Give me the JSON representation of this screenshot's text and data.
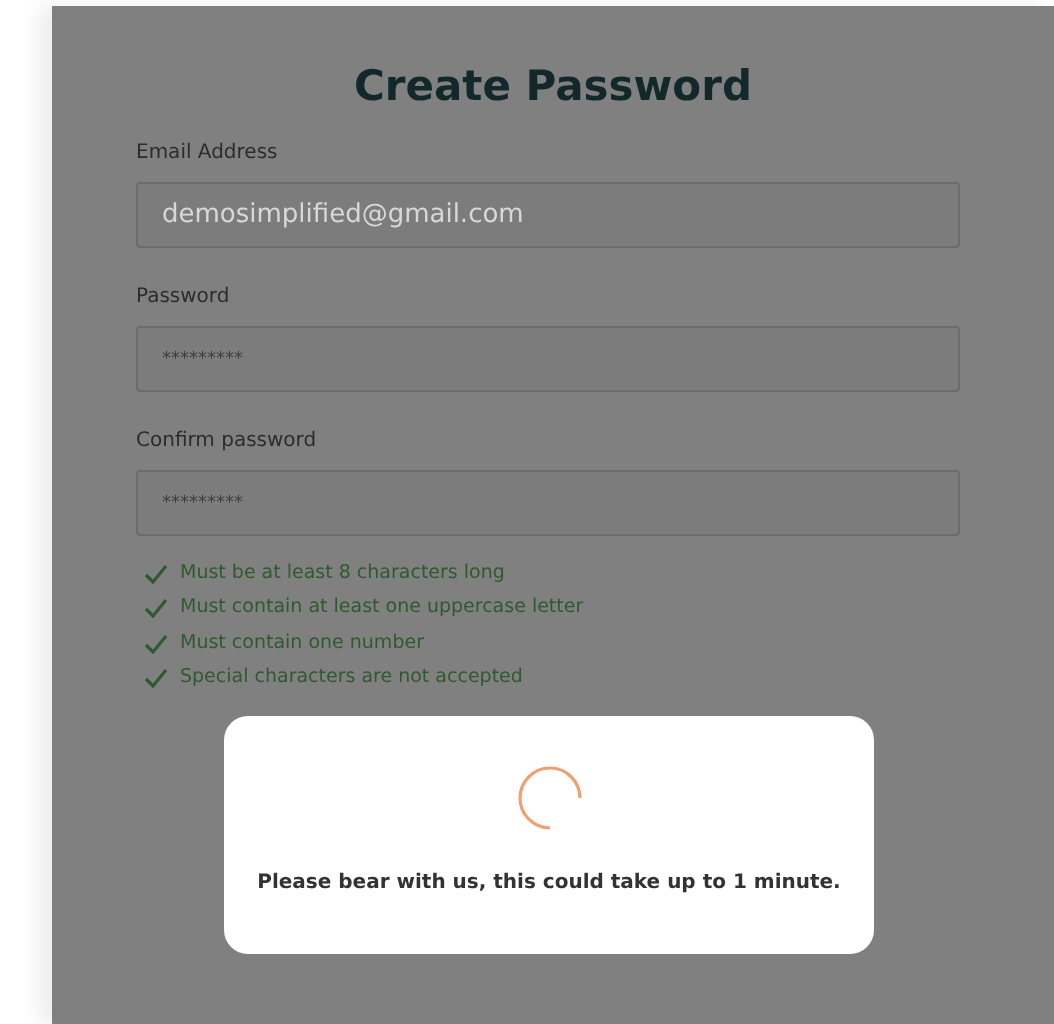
{
  "form": {
    "title": "Create Password",
    "fields": [
      {
        "label": "Email Address",
        "value": "demosimplified@gmail.com",
        "kind": "text"
      },
      {
        "label": "Password",
        "value": "*********",
        "kind": "password"
      },
      {
        "label": "Confirm password",
        "value": "*********",
        "kind": "password"
      }
    ],
    "rules": [
      {
        "text": "Must be at least 8 characters long",
        "met": true
      },
      {
        "text": "Must contain at least one uppercase letter",
        "met": true
      },
      {
        "text": "Must contain one number",
        "met": true
      },
      {
        "text": "Special characters are not accepted",
        "met": true
      }
    ]
  },
  "loading_dialog": {
    "message": "Please bear with us, this could take up to 1 minute."
  }
}
